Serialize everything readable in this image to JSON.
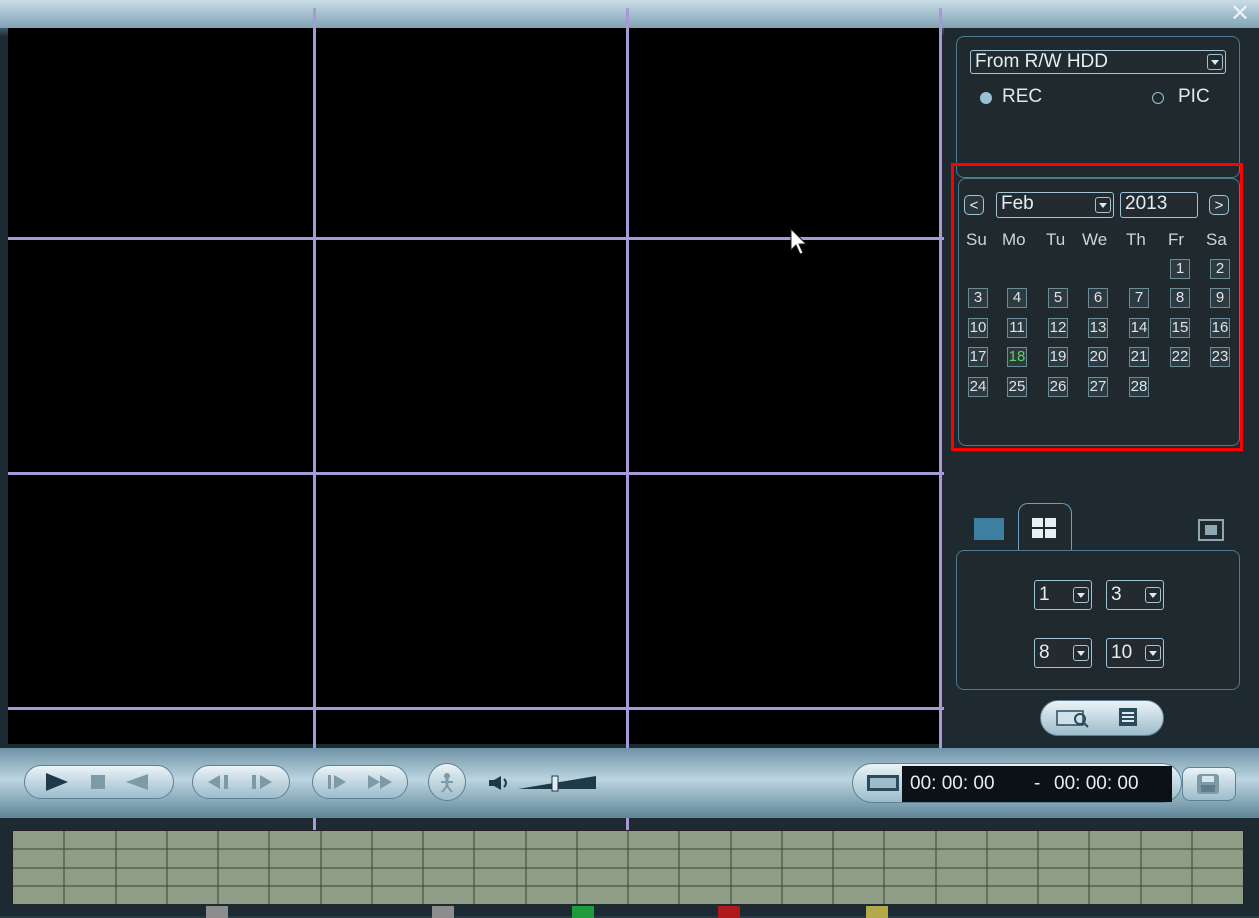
{
  "window": {
    "close_glyph": "✕"
  },
  "source": {
    "selected": "From R/W HDD",
    "options_visible": [
      "From R/W HDD"
    ],
    "radio_rec_label": "REC",
    "radio_pic_label": "PIC",
    "rec_selected": true
  },
  "calendar": {
    "prev_label": "<",
    "next_label": ">",
    "month": "Feb",
    "year": "2013",
    "weekdays": [
      "Su",
      "Mo",
      "Tu",
      "We",
      "Th",
      "Fr",
      "Sa"
    ],
    "today": "18",
    "days": [
      "1",
      "2",
      "3",
      "4",
      "5",
      "6",
      "7",
      "8",
      "9",
      "10",
      "11",
      "12",
      "13",
      "14",
      "15",
      "16",
      "17",
      "18",
      "19",
      "20",
      "21",
      "22",
      "23",
      "24",
      "25",
      "26",
      "27",
      "28"
    ]
  },
  "layout_panel": {
    "icons": [
      "single-view-icon",
      "quad-view-icon",
      "fullscreen-icon"
    ],
    "channel_selects": [
      "1",
      "3",
      "8",
      "10"
    ],
    "search_icon": "search-icon",
    "list_icon": "list-icon"
  },
  "controls": {
    "icons": [
      "play-icon",
      "stop-icon",
      "reverse-play-icon",
      "prev-frame-icon",
      "next-frame-icon",
      "slow-icon",
      "fast-icon",
      "smart-search-icon",
      "volume-icon"
    ],
    "time_from": "00: 00: 00",
    "time_sep": "-",
    "time_to": "00: 00: 00",
    "clip_icon": "clip-icon",
    "save_icon": "save-icon"
  },
  "colors": {
    "accent": "#9fc4d6",
    "grid_line": "#a89ad8",
    "today_green": "#5fd35f",
    "highlight_red": "#ff0000"
  }
}
